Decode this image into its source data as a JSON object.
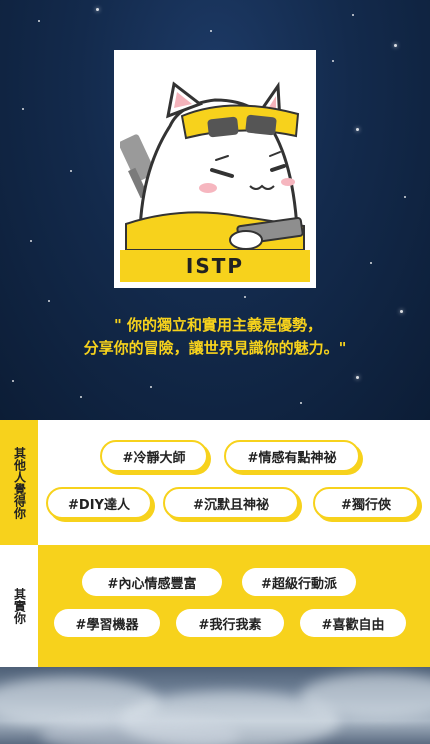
{
  "card": {
    "type_label": "ISTP",
    "accent_color": "#f7d21c"
  },
  "quote": {
    "line1": "\" 你的獨立和實用主義是優勢，",
    "line2": "分享你的冒險，讓世界見識你的魅力。\""
  },
  "others_see": {
    "label": "其他人覺得你",
    "tags": [
      "#冷靜大師",
      "#情感有點神祕",
      "#DIY達人",
      "#沉默且神祕",
      "#獨行俠"
    ]
  },
  "actually": {
    "label": "其實你",
    "tags": [
      "#內心情感豐富",
      "#超級行動派",
      "#學習機器",
      "#我行我素",
      "#喜歡自由"
    ]
  }
}
